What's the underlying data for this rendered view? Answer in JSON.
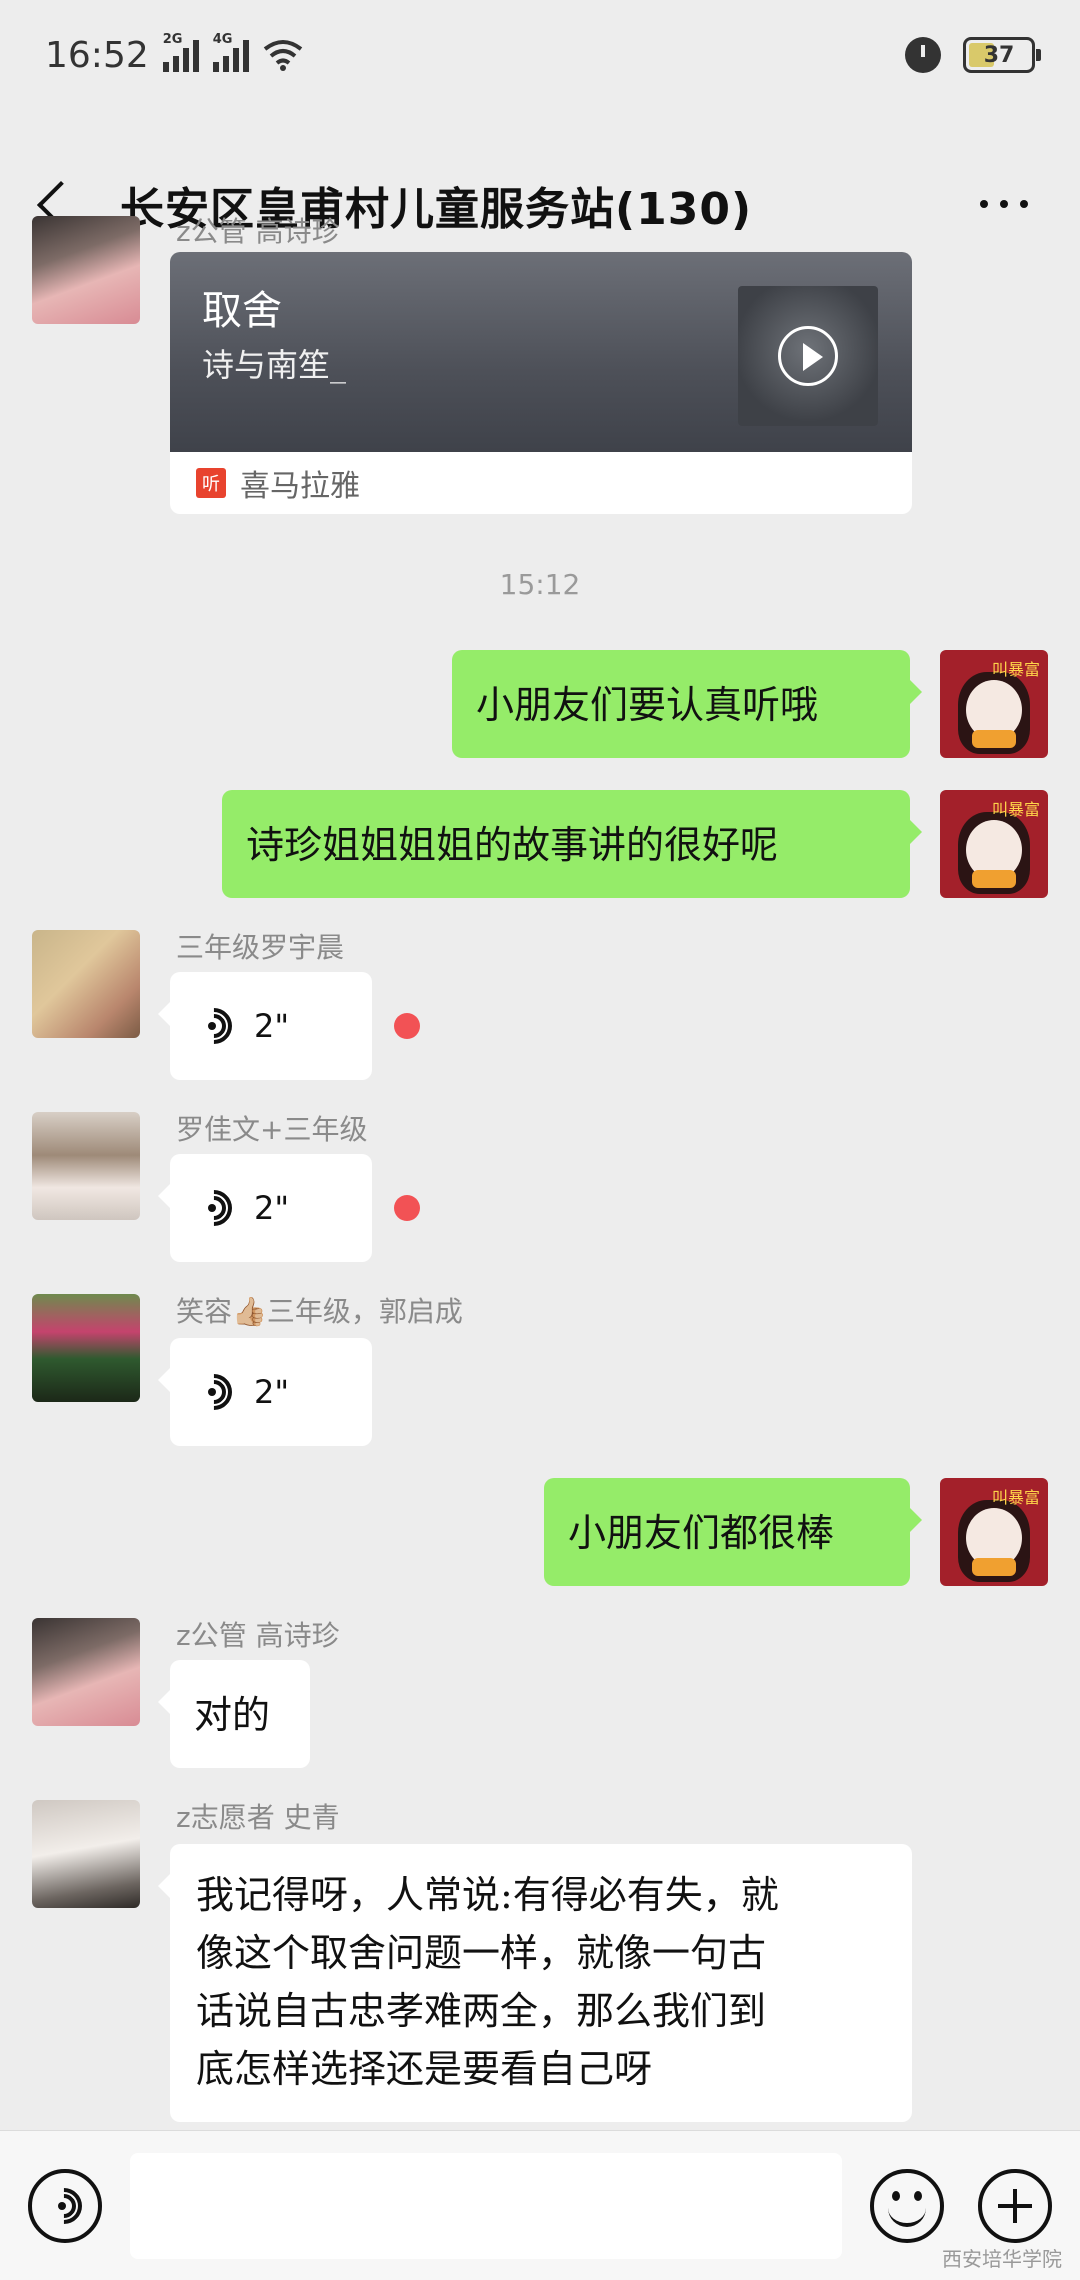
{
  "status_bar": {
    "time": "16:52",
    "signal_1": "2G",
    "signal_2": "4G",
    "battery": "37"
  },
  "header": {
    "title": "长安区皇甫村儿童服务站(130)"
  },
  "messages": [
    {
      "sender": "z公管 高诗珍",
      "card": {
        "title": "取舍",
        "subtitle": "诗与南笙_",
        "source": "喜马拉雅"
      }
    },
    {
      "timestamp": "15:12"
    },
    {
      "text": "小朋友们要认真听哦"
    },
    {
      "text": "诗珍姐姐姐姐的故事讲的很好呢"
    },
    {
      "sender": "三年级罗宇晨",
      "voice": "2\""
    },
    {
      "sender": "罗佳文+三年级",
      "voice": "2\""
    },
    {
      "sender": "笑容👍🏼三年级，郭启成",
      "voice": "2\""
    },
    {
      "text": "小朋友们都很棒"
    },
    {
      "sender": "z公管 高诗珍",
      "text": "对的"
    },
    {
      "sender": "z志愿者 史青",
      "lines": [
        "我记得呀，人常说:有得必有失，就",
        "像这个取舍问题一样，就像一句古",
        "话说自古忠孝难两全，那么我们到",
        "底怎样选择还是要看自己呀"
      ]
    }
  ],
  "avatar_badge": "叫暴富",
  "watermark": "西安培华学院",
  "colors": {
    "background": "#ededed",
    "my_bubble": "#95ec69",
    "other_bubble": "#ffffff",
    "unread_dot": "#f25255"
  }
}
